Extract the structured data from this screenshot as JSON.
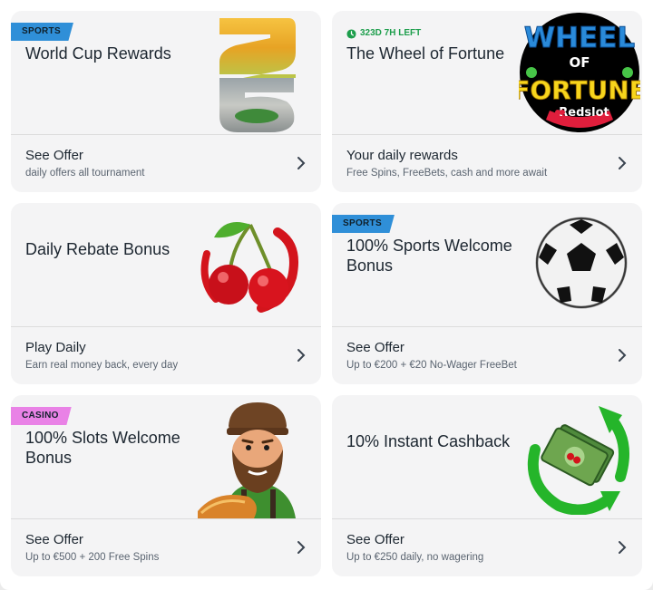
{
  "cards": [
    {
      "badge": "SPORTS",
      "title": "World Cup Rewards",
      "cta": "See Offer",
      "sub": "daily offers all tournament",
      "art": "world-cup-26-image",
      "art_text": "26"
    },
    {
      "timer": "323D 7H LEFT",
      "title": "The Wheel of Fortune",
      "cta": "Your daily rewards",
      "sub": "Free Spins, FreeBets, cash and more await",
      "art": "wheel-of-fortune-logo",
      "logo_line1": "WHEEL",
      "logo_line2": "OF",
      "logo_line3": "FORTUNE",
      "logo_brand": "Redslot"
    },
    {
      "title": "Daily Rebate Bonus",
      "cta": "Play Daily",
      "sub": "Earn real money back, every day",
      "art": "cherries-icon"
    },
    {
      "badge": "SPORTS",
      "title": "100% Sports Welcome Bonus",
      "cta": "See Offer",
      "sub": "Up to €200 + €20 No-Wager FreeBet",
      "art": "soccer-ball-icon"
    },
    {
      "badge": "CASINO",
      "title": "100% Slots Welcome Bonus",
      "cta": "See Offer",
      "sub": "Up to €500 + 200 Free Spins",
      "art": "bearded-lumberjack-mascot"
    },
    {
      "title": "10% Instant Cashback",
      "cta": "See Offer",
      "sub": "Up to €250 daily, no wagering",
      "art": "cashback-money-icon"
    }
  ],
  "colors": {
    "sports_badge": "#2f8fd8",
    "casino_badge": "#e982e6",
    "timer": "#1d9e4c",
    "card_bg": "#f4f4f5"
  }
}
